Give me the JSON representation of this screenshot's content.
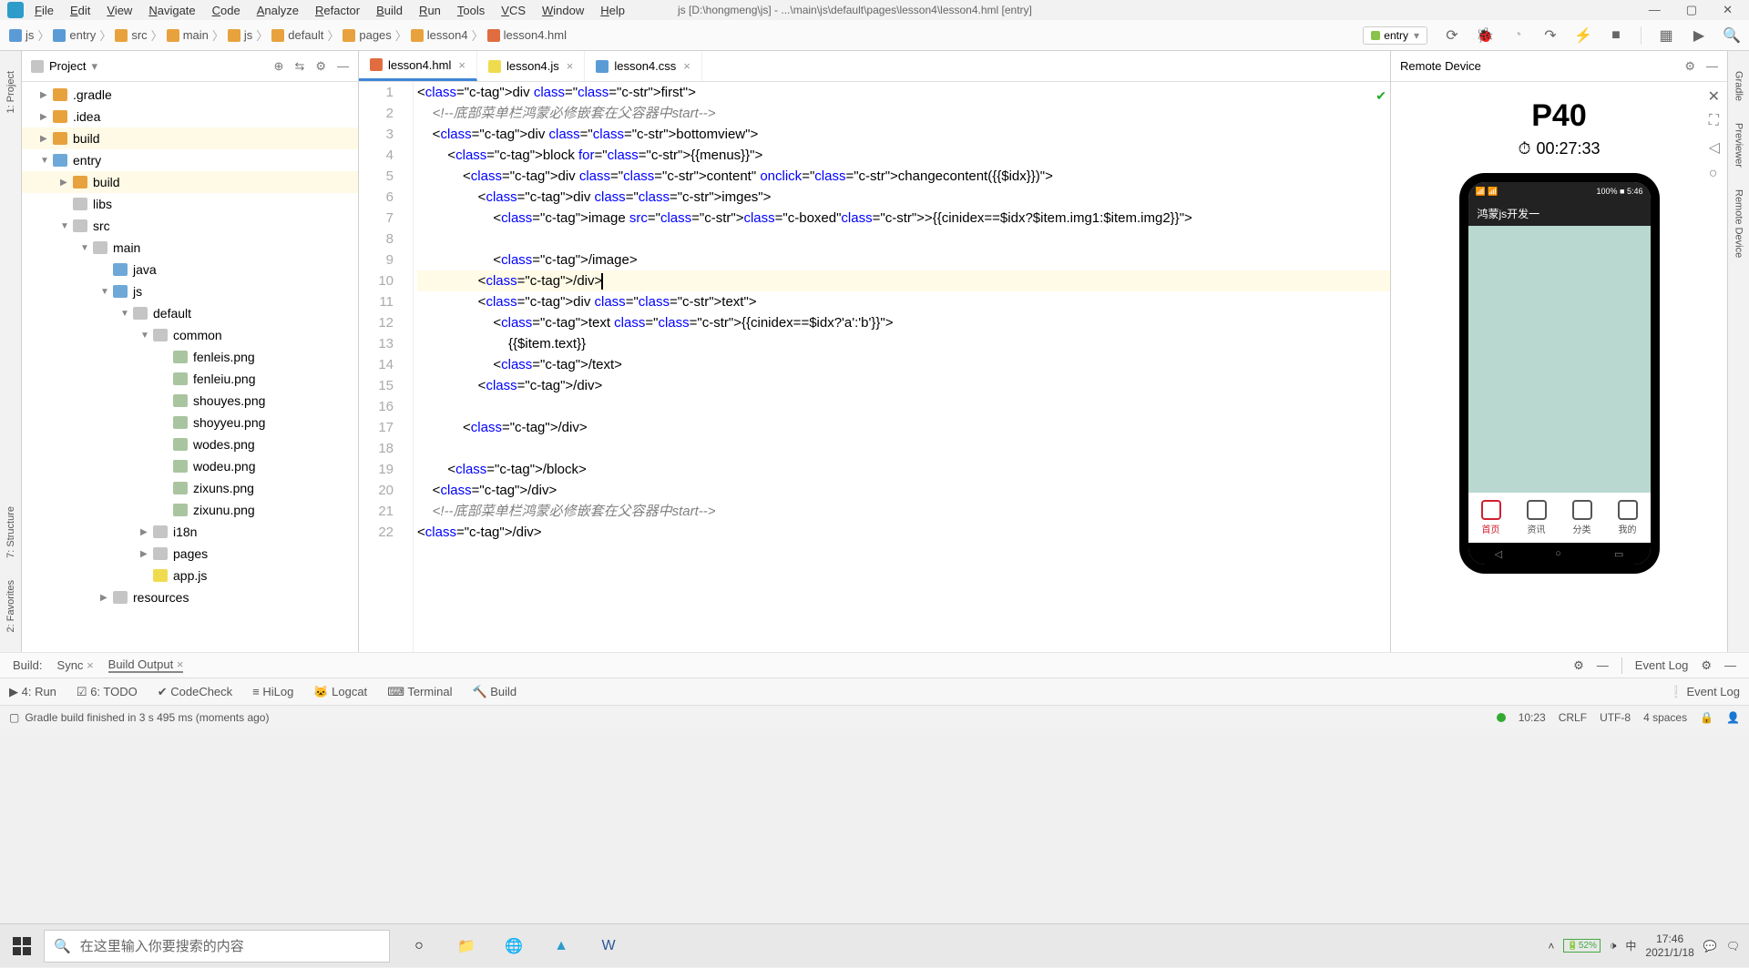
{
  "window": {
    "title": "js [D:\\hongmeng\\js] - ...\\main\\js\\default\\pages\\lesson4\\lesson4.hml [entry]"
  },
  "menu": [
    "File",
    "Edit",
    "View",
    "Navigate",
    "Code",
    "Analyze",
    "Refactor",
    "Build",
    "Run",
    "Tools",
    "VCS",
    "Window",
    "Help"
  ],
  "breadcrumb": [
    "js",
    "entry",
    "src",
    "main",
    "js",
    "default",
    "pages",
    "lesson4",
    "lesson4.hml"
  ],
  "run_config": "entry",
  "project": {
    "title": "Project",
    "tree": [
      {
        "d": 0,
        "a": "▶",
        "ic": "dir-o",
        "n": ".gradle"
      },
      {
        "d": 0,
        "a": "▶",
        "ic": "dir-o",
        "n": ".idea"
      },
      {
        "d": 0,
        "a": "▶",
        "ic": "dir-o",
        "n": "build",
        "sel": true
      },
      {
        "d": 0,
        "a": "▼",
        "ic": "dir-b",
        "n": "entry"
      },
      {
        "d": 1,
        "a": "▶",
        "ic": "dir-o",
        "n": "build",
        "sel": true
      },
      {
        "d": 1,
        "a": "",
        "ic": "dir-g",
        "n": "libs"
      },
      {
        "d": 1,
        "a": "▼",
        "ic": "dir-g",
        "n": "src"
      },
      {
        "d": 2,
        "a": "▼",
        "ic": "dir-g",
        "n": "main"
      },
      {
        "d": 3,
        "a": "",
        "ic": "dir-b",
        "n": "java"
      },
      {
        "d": 3,
        "a": "▼",
        "ic": "dir-b",
        "n": "js"
      },
      {
        "d": 4,
        "a": "▼",
        "ic": "dir-g",
        "n": "default"
      },
      {
        "d": 5,
        "a": "▼",
        "ic": "dir-g",
        "n": "common"
      },
      {
        "d": 6,
        "a": "",
        "ic": "file",
        "n": "fenleis.png"
      },
      {
        "d": 6,
        "a": "",
        "ic": "file",
        "n": "fenleiu.png"
      },
      {
        "d": 6,
        "a": "",
        "ic": "file",
        "n": "shouyes.png"
      },
      {
        "d": 6,
        "a": "",
        "ic": "file",
        "n": "shoyyeu.png"
      },
      {
        "d": 6,
        "a": "",
        "ic": "file",
        "n": "wodes.png"
      },
      {
        "d": 6,
        "a": "",
        "ic": "file",
        "n": "wodeu.png"
      },
      {
        "d": 6,
        "a": "",
        "ic": "file",
        "n": "zixuns.png"
      },
      {
        "d": 6,
        "a": "",
        "ic": "file",
        "n": "zixunu.png"
      },
      {
        "d": 5,
        "a": "▶",
        "ic": "dir-g",
        "n": "i18n"
      },
      {
        "d": 5,
        "a": "▶",
        "ic": "dir-g",
        "n": "pages"
      },
      {
        "d": 5,
        "a": "",
        "ic": "jsf",
        "n": "app.js"
      },
      {
        "d": 3,
        "a": "▶",
        "ic": "dir-g",
        "n": "resources"
      }
    ]
  },
  "tabs": [
    {
      "name": "lesson4.hml",
      "icon": "#e06c3f",
      "active": true
    },
    {
      "name": "lesson4.js",
      "icon": "#f0db4f",
      "active": false
    },
    {
      "name": "lesson4.css",
      "icon": "#5b9bd5",
      "active": false
    }
  ],
  "code_lines": [
    "<div class=\"first\">",
    "    <!--底部菜单栏鸿蒙必修嵌套在父容器中start-->",
    "    <div class=\"bottomview\">",
    "        <block for=\"{{menus}}\">",
    "            <div class=\"content\" onclick=\"changecontent({{$idx}})\">",
    "                <div class=\"imges\">",
    "                    <image src=\"[[{{cinidex==$idx?$item.img1:$item.img2}}]]\">",
    "",
    "                    </image>",
    "                </div>",
    "                <div class=\"text\">",
    "                    <text class=\"{{cinidex==$idx?'a':'b'}}\">",
    "                        {{$item.text}}",
    "                    </text>",
    "                </div>",
    "",
    "            </div>",
    "",
    "        </block>",
    "    </div>",
    "    <!--底部菜单栏鸿蒙必修嵌套在父容器中start-->",
    "</div>"
  ],
  "remote": {
    "title": "Remote Device",
    "device": "P40",
    "timer": "00:27:33",
    "app_title": "鸿蒙js开发一",
    "nav": [
      {
        "label": "首页",
        "active": true
      },
      {
        "label": "资讯",
        "active": false
      },
      {
        "label": "分类",
        "active": false
      },
      {
        "label": "我的",
        "active": false
      }
    ],
    "phone_status_right": "100% ■ 5:46"
  },
  "build": {
    "label": "Build:",
    "sync": "Sync",
    "output": "Build Output",
    "event_log": "Event Log"
  },
  "bottom_tools": [
    "4: Run",
    "6: TODO",
    "CodeCheck",
    "HiLog",
    "Logcat",
    "Terminal",
    "Build"
  ],
  "bottom_right": "Event Log",
  "status": {
    "msg": "Gradle build finished in 3 s 495 ms (moments ago)",
    "time": "10:23",
    "eol": "CRLF",
    "enc": "UTF-8",
    "indent": "4 spaces"
  },
  "left_tabs": [
    "1: Project",
    "7: Structure",
    "2: Favorites"
  ],
  "right_tabs": [
    "Gradle",
    "Previewer",
    "Remote Device"
  ],
  "taskbar": {
    "search_placeholder": "在这里输入你要搜索的内容",
    "battery": "52%",
    "ime": "中",
    "clock": "17:46",
    "date": "2021/1/18"
  }
}
